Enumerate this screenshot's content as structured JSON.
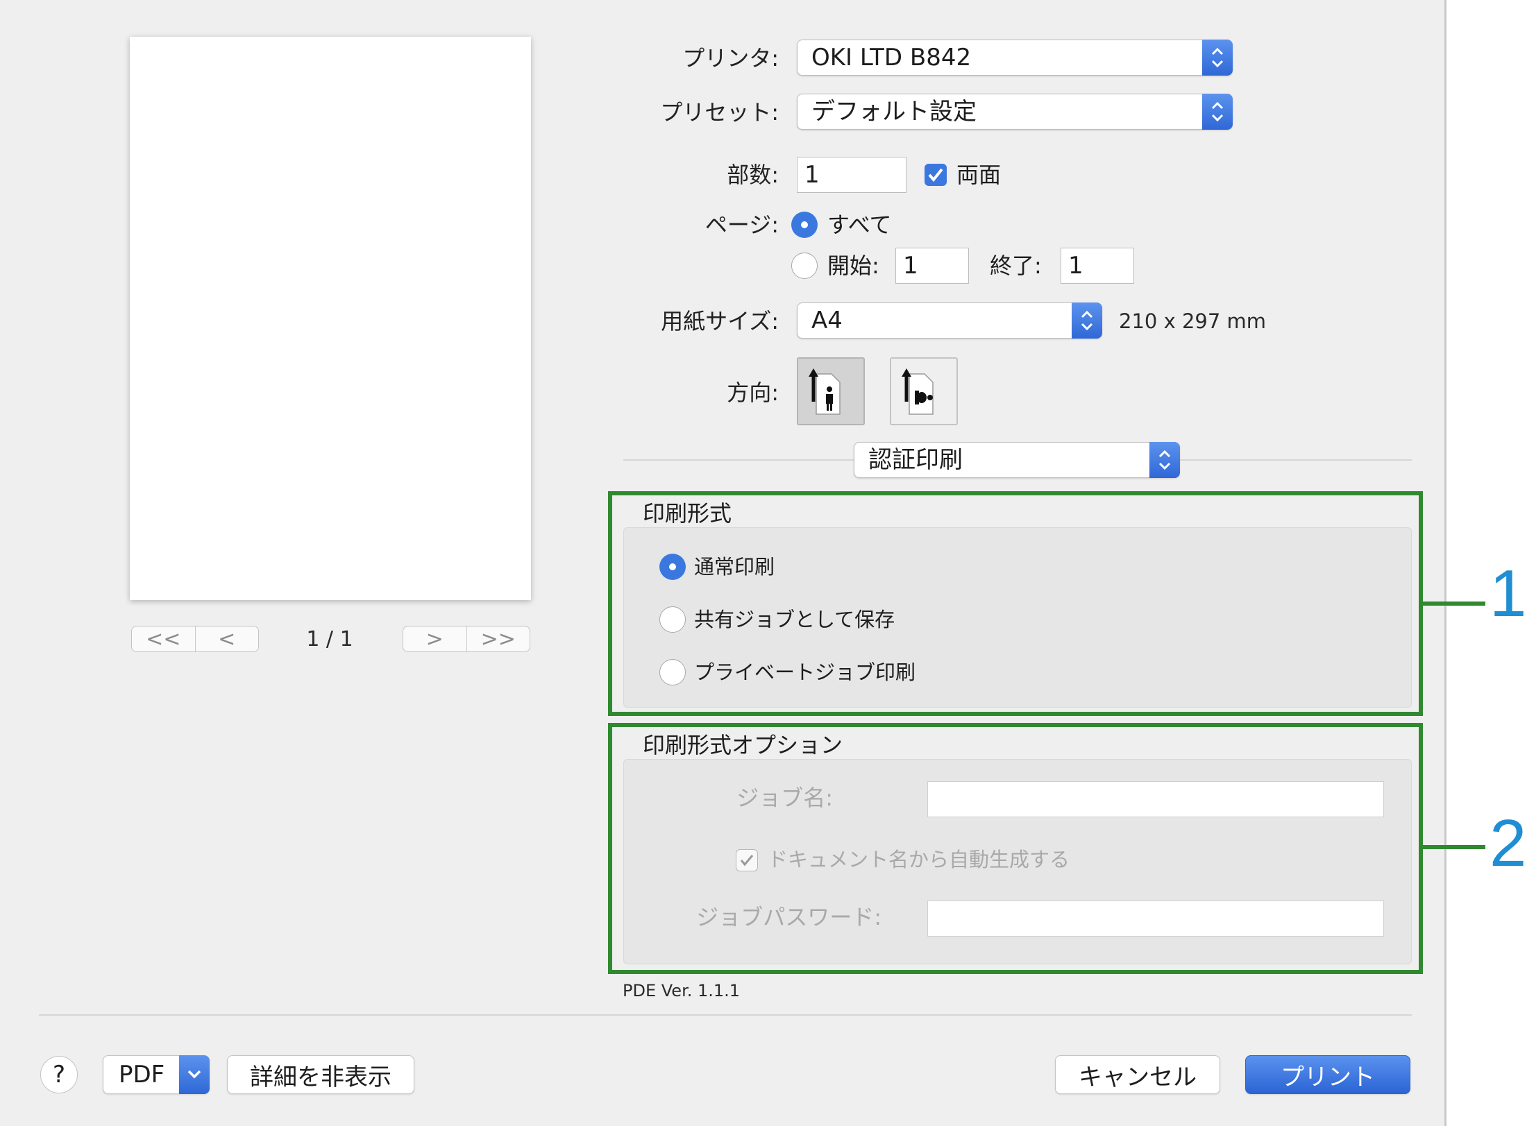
{
  "preview": {
    "page_indicator": "1 / 1",
    "nav": {
      "first": "<<",
      "prev": "<",
      "next": ">",
      "last": ">>"
    }
  },
  "printer": {
    "label": "プリンタ:",
    "value": "OKI LTD B842"
  },
  "preset": {
    "label": "プリセット:",
    "value": "デフォルト設定"
  },
  "copies": {
    "label": "部数:",
    "value": "1",
    "duplex_label": "両面",
    "duplex_checked": true
  },
  "pages": {
    "label": "ページ:",
    "all_label": "すべて",
    "from_label": "開始:",
    "from_value": "1",
    "to_label": "終了:",
    "to_value": "1",
    "selected": "all"
  },
  "paper": {
    "label": "用紙サイズ:",
    "value": "A4",
    "dimensions": "210 x 297 mm"
  },
  "orientation": {
    "label": "方向:",
    "selected": "portrait"
  },
  "panel_menu": {
    "value": "認証印刷"
  },
  "print_format": {
    "title": "印刷形式",
    "options": [
      "通常印刷",
      "共有ジョブとして保存",
      "プライベートジョブ印刷"
    ],
    "selected_index": 0
  },
  "format_options": {
    "title": "印刷形式オプション",
    "job_name_label": "ジョブ名:",
    "job_name_value": "",
    "auto_generate_label": "ドキュメント名から自動生成する",
    "auto_generate_checked": true,
    "password_label": "ジョブパスワード:",
    "password_value": ""
  },
  "version": "PDE Ver. 1.1.1",
  "callouts": [
    "1",
    "2"
  ],
  "footer": {
    "help": "?",
    "pdf": "PDF",
    "hide_details": "詳細を非表示",
    "cancel": "キャンセル",
    "print": "プリント"
  },
  "colors": {
    "accent": "#3a78e0",
    "highlight_border": "#2f8a2f",
    "callout_text": "#1f8ed3"
  }
}
